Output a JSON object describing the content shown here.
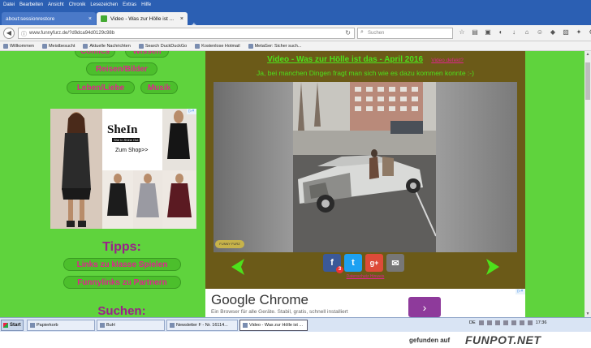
{
  "browser": {
    "menu": [
      "Datei",
      "Bearbeiten",
      "Ansicht",
      "Chronik",
      "Lesezeichen",
      "Extras",
      "Hilfe"
    ],
    "tabs": [
      {
        "label": "about:sessionrestore",
        "close": "×"
      },
      {
        "label": "Video - Was zur Hölle ist ...",
        "close": "×"
      }
    ],
    "new_tab": "+",
    "url": "www.funnyfurz.de/?d9dca94d0129c98b",
    "search_placeholder": "Suchen",
    "bookmarks": [
      "Willkommen",
      "Meistbesucht",
      "Aktuelle Nachrichten",
      "Search DuckDuckGo",
      "Kostenlose Hotmail",
      "MetaGer: Sicher such..."
    ]
  },
  "sidebar": {
    "nav_top": [
      "Comics",
      "Wissen"
    ],
    "nav": [
      "Reisen/Bilder",
      "Leben/Liebe",
      "Musik"
    ],
    "ad": {
      "brand": "SheIn",
      "sub": "She In  Shine Out",
      "cta": "Zum Shop>>",
      "adchoice": "▷×"
    },
    "tipps_heading": "Tipps:",
    "tipps_links": [
      "Links zu klasse Spielen",
      "Funnylinks zu Partnern"
    ],
    "suchen_heading": "Suchen:"
  },
  "main": {
    "title": "Video - Was zur Hölle ist das - April 2016",
    "defect_link": "Video defekt?",
    "subtitle": "Ja, bei manchen Dingen fragt man sich wie es dazu kommen konnte :-)",
    "video_logo": "FUNNY FURZ",
    "share": {
      "facebook": "f",
      "fb_count": "3",
      "twitter": "t",
      "gplus": "g+",
      "mail": "✉"
    },
    "imprint": "Datenschutz Hinweis"
  },
  "ad_chrome": {
    "heading": "Google Chrome",
    "text": "Ein Browser für alle Geräte. Stabil, gratis, schnell installiert",
    "button": "›",
    "adchoice": "▷×"
  },
  "taskbar": {
    "start": "Start",
    "tasks": [
      "Papierkorb",
      "BuH",
      "Newsletter F - Nr. 16114...",
      "Video - Was zur Hölle ist ..."
    ],
    "lang": "DE",
    "clock": "17:36"
  },
  "watermark": {
    "prefix": "gefunden auf",
    "brand": "FUNPOT.NET"
  },
  "colors": {
    "page_bg": "#5fd33d",
    "pill_text": "#e0238e",
    "content_bg": "#6b5a18",
    "title_green": "#4de11b",
    "heading_purple": "#9b1f8a"
  }
}
